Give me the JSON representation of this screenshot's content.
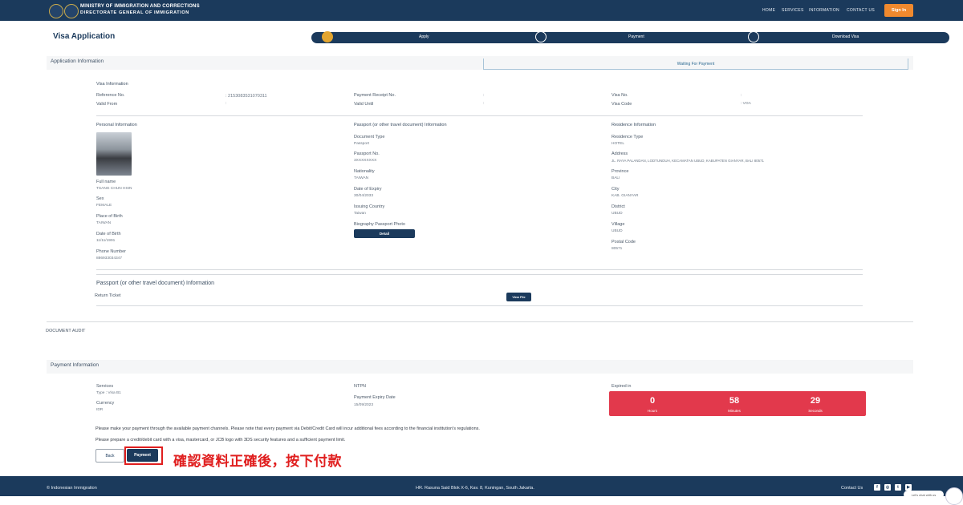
{
  "header": {
    "brand_line1": "MINISTRY OF IMMIGRATION AND CORRECTIONS",
    "brand_line2": "DIRECTORATE GENERAL OF IMMIGRATION",
    "nav": [
      "HOME",
      "SERVICES",
      "INFORMATION",
      "CONTACT US"
    ],
    "signin_label": "Sign In"
  },
  "page_title": "Visa Application",
  "steps": [
    "Apply",
    "Payment",
    "Download Visa"
  ],
  "application_info": {
    "heading": "Application Information",
    "status": "Waiting For Payment",
    "visa_info_title": "Visa Information",
    "reference_label": "Reference No.",
    "reference_value": ": 2153083531070311",
    "valid_from_label": "Valid From",
    "valid_from_value": ":",
    "payment_receipt_label": "Payment Receipt No.",
    "payment_receipt_value": ":",
    "valid_until_label": "Valid Until",
    "valid_until_value": ":",
    "visa_no_label": "Visa No.",
    "visa_no_value": ":",
    "visa_code_label": "Visa Code",
    "visa_code_value": ": VOA"
  },
  "personal": {
    "title": "Personal Information",
    "fullname_label": "Full name",
    "fullname_value": "TSANG CHUN HSIN",
    "sex_label": "Sex",
    "sex_value": "FEMALE",
    "pob_label": "Place of Birth",
    "pob_value": "TAIWAN",
    "dob_label": "Date of Birth",
    "dob_value": "11/11/1991",
    "phone_label": "Phone Number",
    "phone_value": "886933034347"
  },
  "passport": {
    "title": "Passport (or other travel document) Information",
    "doctype_label": "Document Type",
    "doctype_value": "Passport",
    "passno_label": "Passport No.",
    "passno_value": "3XXXXXXXX",
    "nationality_label": "Nationality",
    "nationality_value": "TAIWAN",
    "expiry_label": "Date of Expiry",
    "expiry_value": "30/04/2033",
    "issuing_label": "Issuing Country",
    "issuing_value": "Taiwan",
    "bio_label": "Biography Passport Photo",
    "bio_btn": "Detail"
  },
  "residence": {
    "title": "Residence Information",
    "type_label": "Residence Type",
    "type_value": "HOTEL",
    "address_label": "Address",
    "address_value": "JL. RAYA PALANDAN, LODTUNDUH, KECAMATAN UBUD, KABUPATEN GIANYAR, BALI 80571",
    "province_label": "Province",
    "province_value": "BALI",
    "city_label": "City",
    "city_value": "KAB. GIANYAR",
    "district_label": "District",
    "district_value": "UBUD",
    "village_label": "Village",
    "village_value": "UBUD",
    "postal_label": "Postal Code",
    "postal_value": "80571"
  },
  "travel_doc": {
    "title": "Passport (or other travel document) Information",
    "return_label": "Return Ticket",
    "return_btn": "View File"
  },
  "document_audit": "DOCUMENT AUDIT",
  "payment": {
    "heading": "Payment Information",
    "services_label": "Services",
    "services_value": "Type : Visa B1",
    "currency_label": "Currency",
    "currency_value": "IDR",
    "ntpn_label": "NTPN",
    "expiry_label": "Payment Expiry Date",
    "expiry_value": "15/09/2023",
    "expired_in_label": "Expired in",
    "hours_num": "0",
    "hours_lbl": "Hours",
    "minutes_num": "58",
    "minutes_lbl": "Minutes",
    "seconds_num": "29",
    "seconds_lbl": "Seconds",
    "notice1": "Please make your payment through the available payment channels. Please note that every payment via Debit/Credit Card will incur additional fees according to the financial institution's regulations.",
    "notice2": "Please prepare a credit/debit card with a visa, mastercard, or JCB logo with 3DS security features and a sufficient payment limit.",
    "back_label": "Back",
    "pay_label": "Payment"
  },
  "annotation": "確認資料正確後，按下付款",
  "footer": {
    "copyright": "© Indonesian Immigration",
    "address": "HR. Rasuna Said Blok X-6, Kav. 8, Kuningan, South Jakarta.",
    "contact": "Contact Us",
    "chat_label": "Let's chat with us"
  },
  "colors": {
    "navy": "#1b3a5c",
    "orange": "#f0892e",
    "countdown_red": "#e2394c",
    "annotation_red": "#e01e1e"
  }
}
